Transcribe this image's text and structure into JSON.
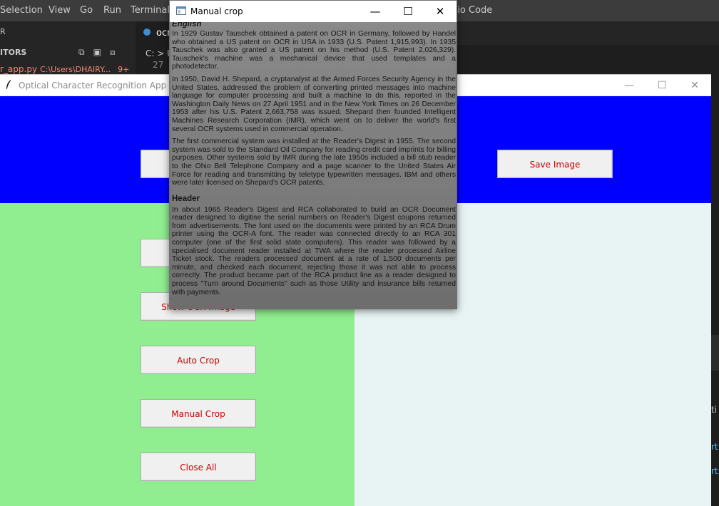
{
  "vscode": {
    "menu": [
      "Selection",
      "View",
      "Go",
      "Run",
      "Terminal"
    ],
    "title_fragment": "dio Code",
    "sidebar_header_char": "R",
    "open_editors_label": "ITORS",
    "file_name": "r_app.py",
    "file_path": "C:\\Users\\DHAIRY...",
    "file_problems": "9+",
    "tab_label": "ocr",
    "breadcrumb": "C: > U",
    "line_number": "27",
    "right_edge_text": [
      "ti",
      "rt",
      "rt"
    ]
  },
  "ocr_app": {
    "title": "Optical Character Recognition App",
    "controls": {
      "minimize": "—",
      "maximize": "☐",
      "close": "✕"
    },
    "buttons": {
      "save_image": "Save Image",
      "show_ocr_image": "Show OCR Image",
      "auto_crop": "Auto Crop",
      "manual_crop": "Manual Crop",
      "close_all": "Close All"
    },
    "colors": {
      "top_panel": "#0000ff",
      "left_panel": "#90ee90",
      "right_panel": "#e8f4f4",
      "button_text": "#cc0000"
    }
  },
  "crop_window": {
    "title": "Manual crop",
    "controls": {
      "minimize": "—",
      "maximize": "☐",
      "close": "✕"
    },
    "document": {
      "heading1": "English",
      "para1": "In 1929 Gustav Tauschek obtained a patent on OCR in Germany, followed by Handel who obtained a US patent on OCR in USA in 1933 (U.S. Patent 1,915,993). In 1935 Tauschek was also granted a US patent on his method (U.S. Patent 2,026,329). Tauschek's machine was a mechanical device that used templates and a photodetector.",
      "para2": "In 1950, David H. Shepard, a cryptanalyst at the Armed Forces Security Agency in the United States, addressed the problem of converting printed messages into machine language for computer processing and built a machine to do this, reported in the Washington Daily News on 27 April 1951 and in the New York Times on 26 December 1953 after his U.S. Patent 2,663,758 was issued. Shepard then founded Intelligent Machines Research Corporation (IMR), which went on to deliver the world's first several OCR systems used in commercial operation.",
      "para3": "The first commercial system was installed at the Reader's Digest in 1955. The second system was sold to the Standard Oil Company for reading credit card imprints for billing purposes. Other systems sold by IMR during the late 1950s included a bill stub reader to the Ohio Bell Telephone Company and a page scanner to the United States Air Force for reading and transmitting by teletype typewritten messages. IBM and others were later licensed on Shepard's OCR patents.",
      "heading2": "Header",
      "para4": "In about 1965 Reader's Digest and RCA collaborated to build an OCR Document reader designed to digitise the serial numbers on Reader's Digest coupons returned from advertisements. The font used on the documents were printed by an RCA Drum printer using the OCR-A font. The reader was connected directly to an RCA 301 computer (one of the first solid state computers). This reader was followed by a specialised document reader installed at TWA where the reader processed Airline Ticket stock. The readers processed document at a rate of 1,500 documents per minute, and checked each document, rejecting those it was not able to process correctly. The product became part of the RCA product line as a reader designed to process \"Turn around Documents\" such as those Utility and insurance bills returned with payments."
    }
  }
}
